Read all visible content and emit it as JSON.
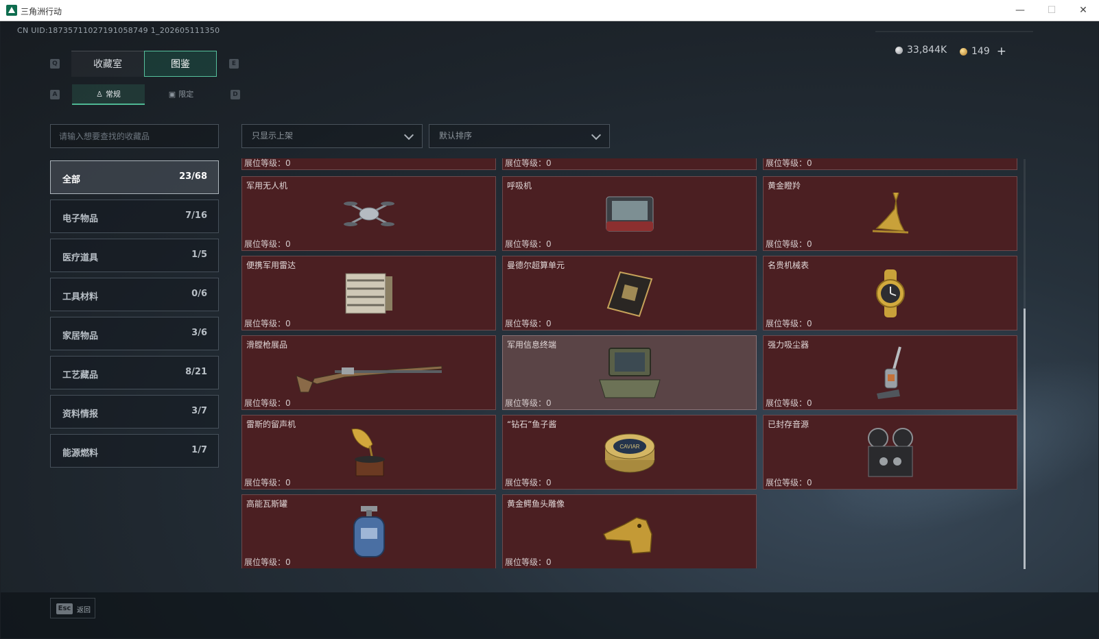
{
  "window": {
    "title": "三角洲行动",
    "minimize": "—",
    "maximize": "☐",
    "close": "✕"
  },
  "uid": "CN UID:18735711027191058749 1_202605111350",
  "currency": {
    "silver": "33,844K",
    "gold": "149",
    "plus": "+"
  },
  "keys": {
    "tab_prev": "Q",
    "tab_next": "E",
    "sub_prev": "A",
    "sub_next": "D"
  },
  "tabs": [
    {
      "label": "收藏室"
    },
    {
      "label": "图鉴",
      "active": true
    }
  ],
  "subtabs": [
    {
      "label": "常规",
      "active": true
    },
    {
      "label": "限定"
    }
  ],
  "search": {
    "placeholder": "请输入想要查找的收藏品"
  },
  "filters": {
    "display": "只显示上架",
    "sort": "默认排序"
  },
  "categories": [
    {
      "name": "全部",
      "count": "23/68",
      "active": true
    },
    {
      "name": "电子物品",
      "count": "7/16"
    },
    {
      "name": "医疗道具",
      "count": "1/5"
    },
    {
      "name": "工具材料",
      "count": "0/6"
    },
    {
      "name": "家居物品",
      "count": "3/6"
    },
    {
      "name": "工艺藏品",
      "count": "8/21"
    },
    {
      "name": "资料情报",
      "count": "3/7"
    },
    {
      "name": "能源燃料",
      "count": "1/7"
    }
  ],
  "items": [
    {
      "name": "",
      "level": "展位等级：0"
    },
    {
      "name": "",
      "level": "展位等级：0"
    },
    {
      "name": "",
      "level": "展位等级：0"
    },
    {
      "name": "军用无人机",
      "level": "展位等级：0",
      "icon": "drone"
    },
    {
      "name": "呼吸机",
      "level": "展位等级：0",
      "icon": "ventilator"
    },
    {
      "name": "黄金瞪羚",
      "level": "展位等级：0",
      "icon": "gazelle"
    },
    {
      "name": "便携军用雷达",
      "level": "展位等级：0",
      "icon": "radar"
    },
    {
      "name": "曼德尔超算单元",
      "level": "展位等级：0",
      "icon": "chip"
    },
    {
      "name": "名贵机械表",
      "level": "展位等级：0",
      "icon": "watch"
    },
    {
      "name": "滑膛枪展品",
      "level": "展位等级：0",
      "icon": "musket"
    },
    {
      "name": "军用信息终端",
      "level": "展位等级：0",
      "icon": "terminal",
      "selected": true
    },
    {
      "name": "强力吸尘器",
      "level": "展位等级：0",
      "icon": "vacuum"
    },
    {
      "name": "雷斯的留声机",
      "level": "展位等级：0",
      "icon": "gramophone"
    },
    {
      "name": "“钻石”鱼子酱",
      "level": "展位等级：0",
      "icon": "caviar",
      "art_text": "CAVIAR"
    },
    {
      "name": "已封存音源",
      "level": "展位等级：0",
      "icon": "reel-recorder"
    },
    {
      "name": "高能瓦斯罐",
      "level": "展位等级：0",
      "icon": "gas-canister"
    },
    {
      "name": "黄金鳄鱼头雕像",
      "level": "展位等级：0",
      "icon": "crocodile-head"
    }
  ],
  "footer": {
    "esc_key": "Esc",
    "esc_label": "返回"
  }
}
